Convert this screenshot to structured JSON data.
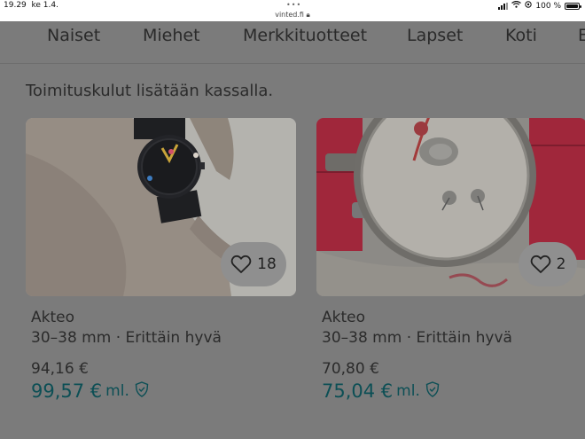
{
  "status_bar": {
    "time": "19.29",
    "date": "ke 1.4.",
    "url": "vinted.fi",
    "battery": "100 %"
  },
  "nav": {
    "items": [
      "Naiset",
      "Miehet",
      "Merkkituotteet",
      "Lapset",
      "Koti",
      "E"
    ]
  },
  "notice": "Toimituskulut lisätään kassalla.",
  "listings": [
    {
      "brand": "Akteo",
      "details": "30–38 mm · Erittäin hyvä",
      "price": "94,16 €",
      "total_price": "99,57 €",
      "total_suffix": "ml.",
      "favourites": "18",
      "image": "black-wristwatch-photo"
    },
    {
      "brand": "Akteo",
      "details": "30–38 mm · Erittäin hyvä",
      "price": "70,80 €",
      "total_price": "75,04 €",
      "total_suffix": "ml.",
      "favourites": "2",
      "image": "red-strap-cat-wristwatch-photo"
    }
  ],
  "colors": {
    "total_price": "#0c4f55",
    "dim_overlay": "#7b7b7b"
  }
}
